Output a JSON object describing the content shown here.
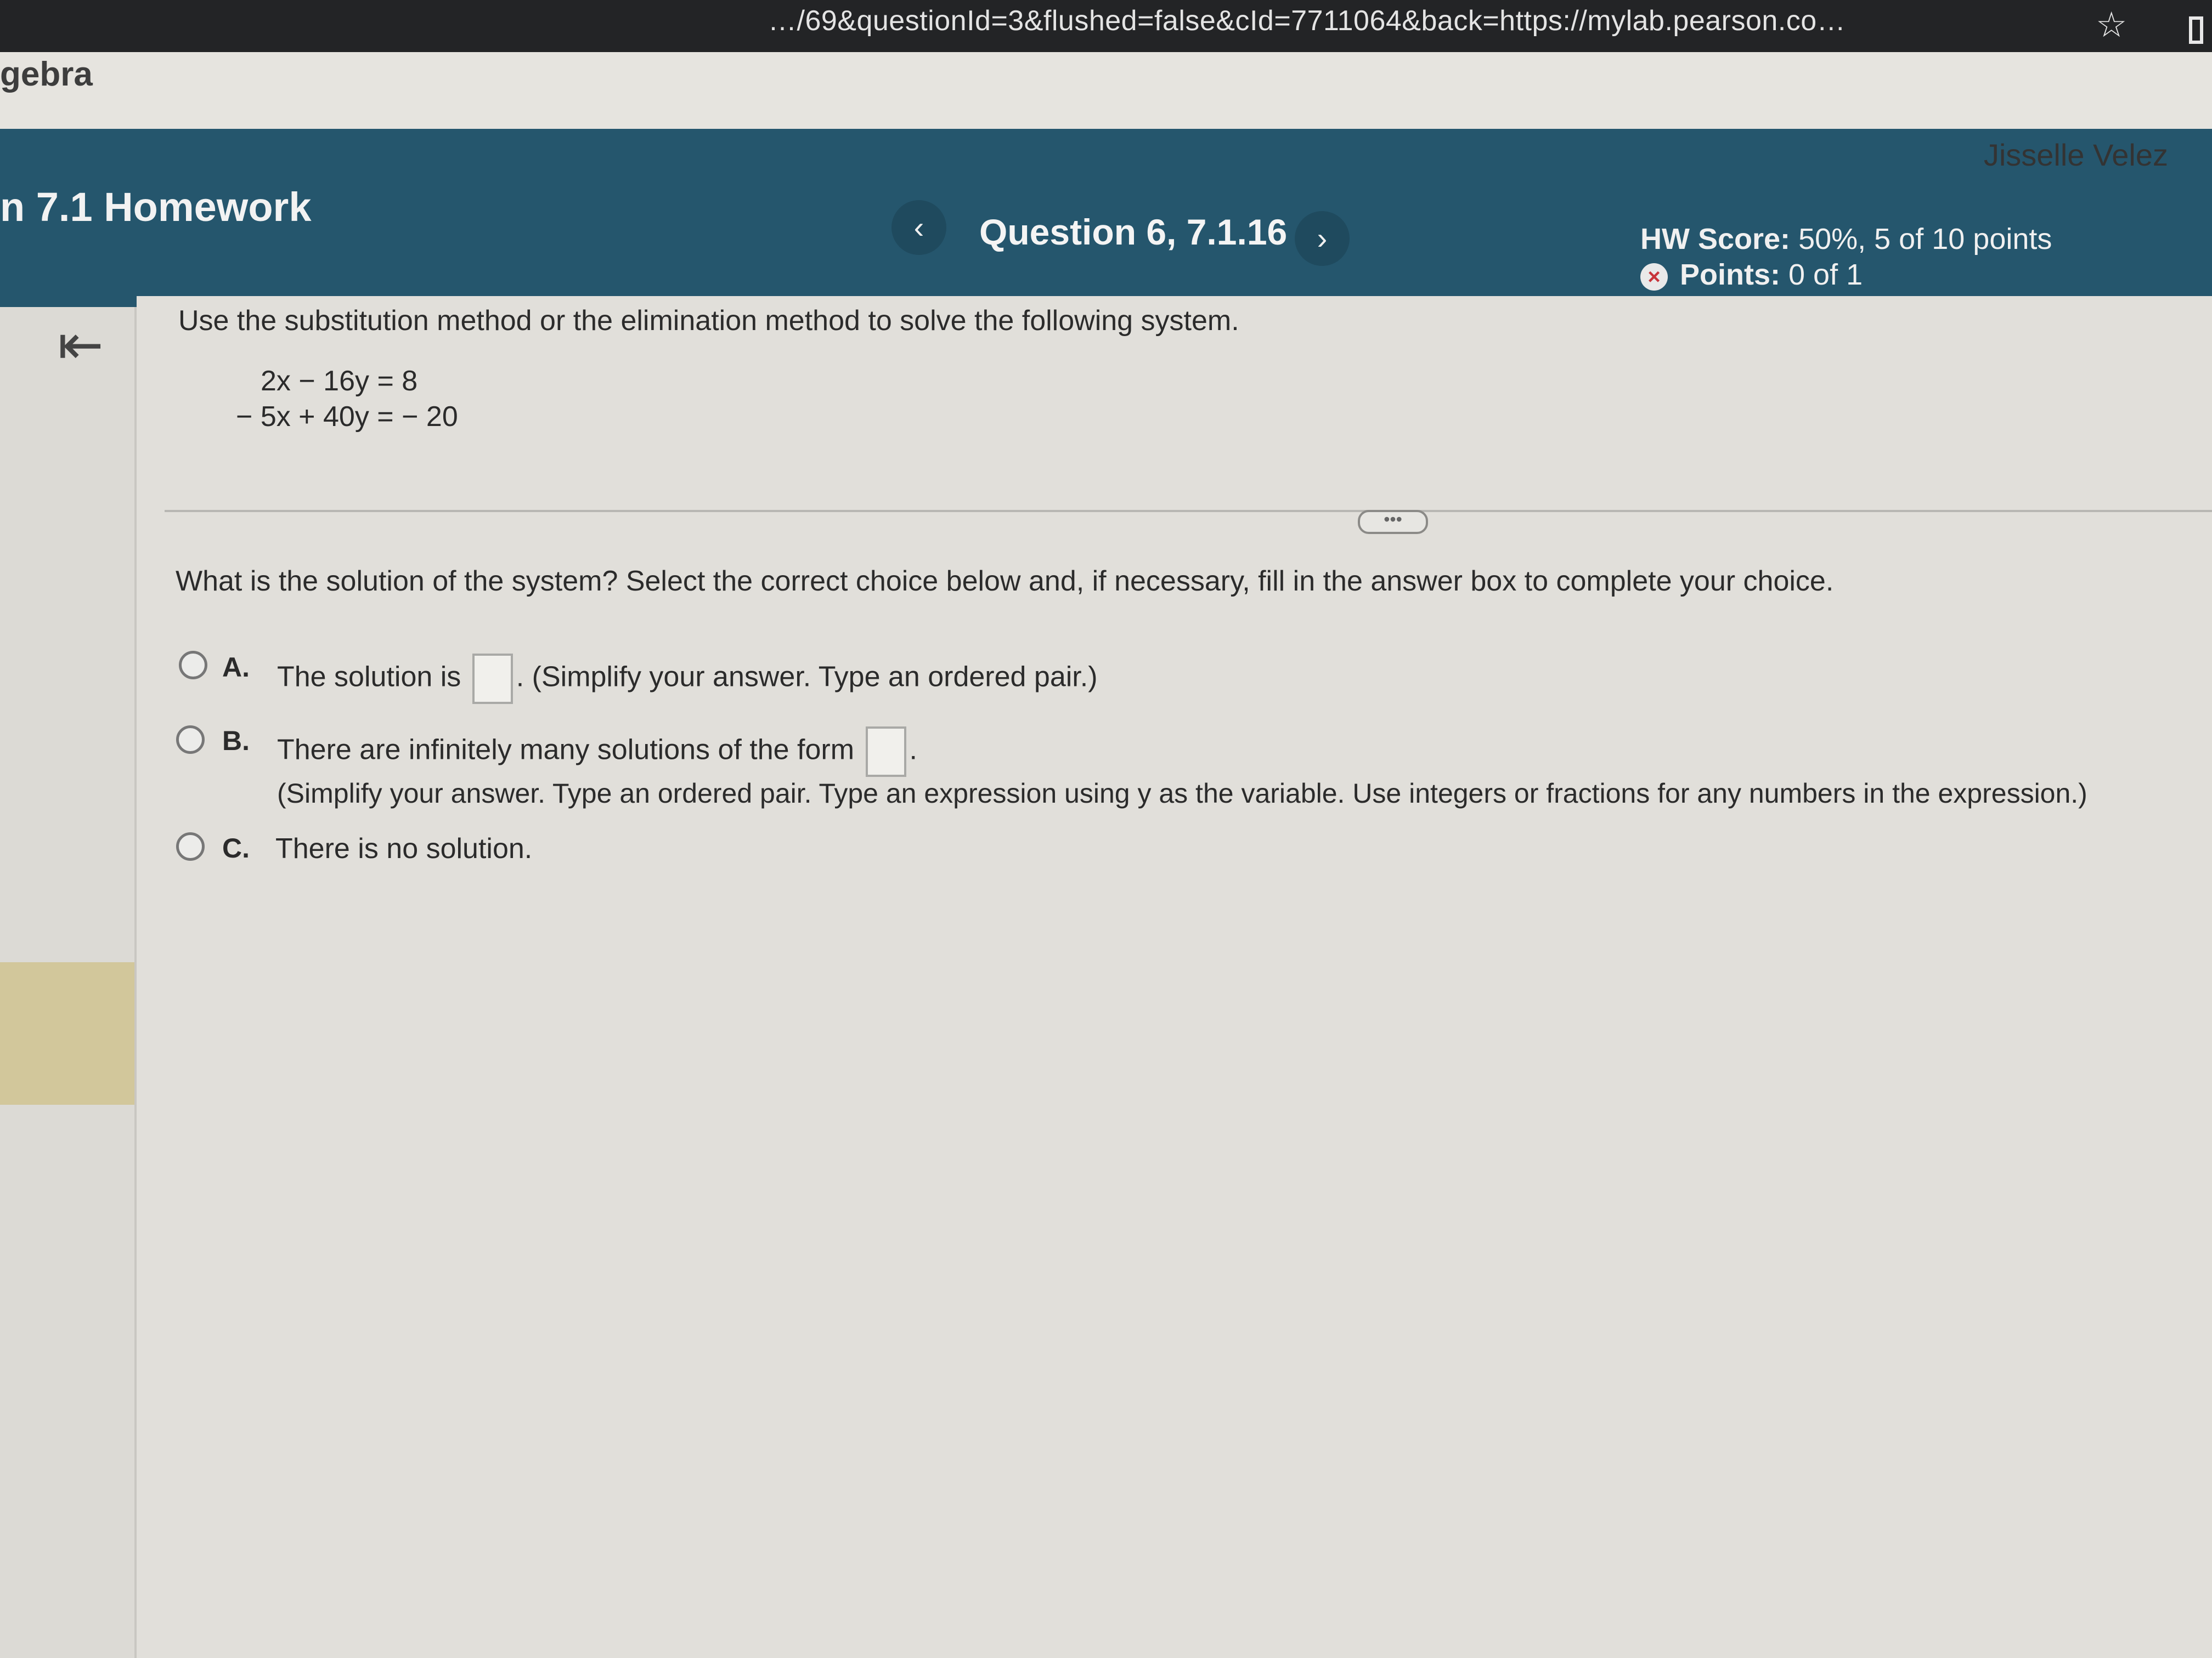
{
  "browser": {
    "url": "…/69&questionId=3&flushed=false&cId=7711064&back=https://mylab.pearson.co…"
  },
  "course": {
    "title": "gebra"
  },
  "user": {
    "name": "Jisselle Velez"
  },
  "header": {
    "assignment": "n 7.1 Homework",
    "question_label": "Question 6, 7.1.16",
    "hw_score_label": "HW Score:",
    "hw_score_value": "50%, 5 of 10 points",
    "points_label": "Points:",
    "points_value": "0 of 1"
  },
  "question": {
    "instruction": "Use the substitution method or the elimination method to solve the following system.",
    "equations": [
      "2x − 16y =   8",
      "− 5x + 40y = − 20"
    ],
    "prompt": "What is the solution of the system? Select the correct choice below and, if necessary, fill in the answer box to complete your choice.",
    "choices": [
      {
        "letter": "A.",
        "before": "The solution is",
        "after": ". (Simplify your answer. Type an ordered pair.)"
      },
      {
        "letter": "B.",
        "before": "There are infinitely many solutions of the form",
        "after": ".",
        "note": "(Simplify your answer. Type an ordered pair. Type an expression using y as the variable. Use integers or fractions for any numbers in the expression.)"
      },
      {
        "letter": "C.",
        "before": "There is no solution."
      }
    ]
  },
  "icons": {
    "prev": "chevron-left-icon",
    "next": "chevron-right-icon",
    "star": "star-icon",
    "status": "x-circle-icon",
    "collapse": "collapse-left-icon"
  },
  "colors": {
    "header_band": "#25566d",
    "error_icon": "#c8343a"
  }
}
